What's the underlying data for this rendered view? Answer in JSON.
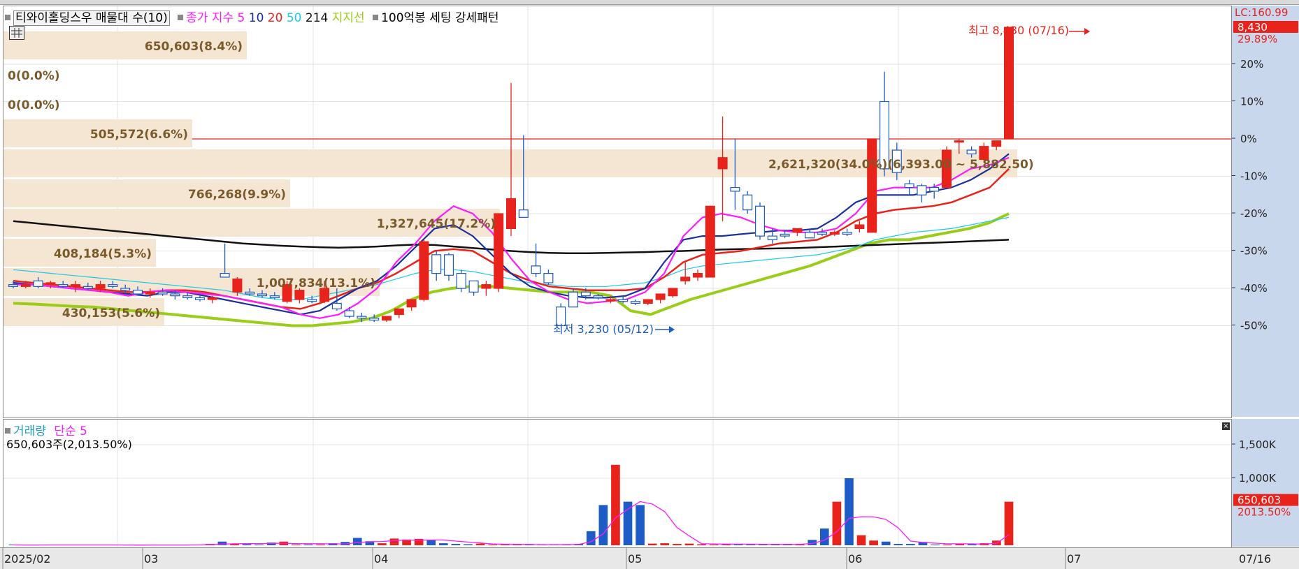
{
  "legend": {
    "stock_name": "티와이홀딩스우 매물대 수(10)",
    "ma_label": "종가 지수 5",
    "ma10": "10",
    "ma20": "20",
    "ma50": "50",
    "ma214": "214",
    "support_line": "지지선",
    "pattern_label": "100억봉 세팅 강세패턴"
  },
  "price_axis": {
    "lc_label": "LC:160.99",
    "current_price": "8,430",
    "current_change": "29.89%",
    "ticks": [
      "20%",
      "10%",
      "0%",
      "-10%",
      "-20%",
      "-30%",
      "-40%",
      "-50%"
    ]
  },
  "annotations": {
    "high": "최고 8,430 (07/16)",
    "low": "최저 3,230 (05/12)"
  },
  "volume_profile": [
    {
      "label": "650,603(8.4%)"
    },
    {
      "label": "0(0.0%)"
    },
    {
      "label": "0(0.0%)"
    },
    {
      "label": "505,572(6.6%)"
    },
    {
      "label": "2,621,320(34.0%)(6,393.00 ~ 5,882.50)"
    },
    {
      "label": "766,268(9.9%)"
    },
    {
      "label": "1,327,645(17.2%)"
    },
    {
      "label": "408,184(5.3%)"
    },
    {
      "label": "1,007,834(13.1%)"
    },
    {
      "label": "430,153(5.6%)"
    }
  ],
  "volume_panel": {
    "title": "거래량",
    "ma_label": "단순 5",
    "info": "650,603주(2,013.50%)",
    "axis_ticks": [
      "1,500K",
      "1,000K"
    ],
    "current_volume": "650,603",
    "current_pct": "2013.50%"
  },
  "date_axis": {
    "labels": [
      "2025/02",
      "03",
      "04",
      "05",
      "06",
      "07"
    ],
    "current_date": "07/16"
  },
  "colors": {
    "up": "#e8231b",
    "down": "#1d5bc6",
    "ma5": "#ff1aff",
    "ma10": "#1a2fa0",
    "ma20": "#e8231b",
    "ma50": "#1ec8e8",
    "ma214": "#111111",
    "support": "#9acd18",
    "profile_fill": "#f4e6d2",
    "profile_text": "#7a5a2a",
    "axis_bg": "#c9d7ec"
  },
  "chart_data": {
    "type": "candlestick",
    "reference_price": 6490,
    "price_pct_range": [
      -55,
      35
    ],
    "volume_range_k": [
      0,
      1700
    ],
    "candles": [
      {
        "date": "02/03",
        "o": -39,
        "h": -38,
        "l": -40,
        "c": -39.5
      },
      {
        "date": "02/05",
        "o": -39.5,
        "h": -38,
        "l": -40,
        "c": -39
      },
      {
        "date": "02/07",
        "o": -38,
        "h": -37,
        "l": -40,
        "c": -39.5
      },
      {
        "date": "02/10",
        "o": -39,
        "h": -38,
        "l": -40,
        "c": -38.5
      },
      {
        "date": "02/12",
        "o": -39,
        "h": -38,
        "l": -40,
        "c": -39.5
      },
      {
        "date": "02/14",
        "o": -39.5,
        "h": -38,
        "l": -41,
        "c": -39
      },
      {
        "date": "02/18",
        "o": -39.5,
        "h": -38.5,
        "l": -40.5,
        "c": -40
      },
      {
        "date": "02/20",
        "o": -40,
        "h": -38,
        "l": -41,
        "c": -39
      },
      {
        "date": "02/24",
        "o": -39,
        "h": -38,
        "l": -40,
        "c": -39.5
      },
      {
        "date": "02/26",
        "o": -40,
        "h": -39,
        "l": -41,
        "c": -40.5
      },
      {
        "date": "02/28",
        "o": -40.5,
        "h": -39.5,
        "l": -42,
        "c": -41.5
      },
      {
        "date": "03/04",
        "o": -41.5,
        "h": -40,
        "l": -42.5,
        "c": -41
      },
      {
        "date": "03/06",
        "o": -41,
        "h": -40,
        "l": -42,
        "c": -41.5
      },
      {
        "date": "03/10",
        "o": -41.5,
        "h": -40.5,
        "l": -43,
        "c": -42
      },
      {
        "date": "03/12",
        "o": -42,
        "h": -41,
        "l": -43,
        "c": -42.5
      },
      {
        "date": "03/14",
        "o": -42.5,
        "h": -41.5,
        "l": -43.5,
        "c": -43
      },
      {
        "date": "03/18",
        "o": -43,
        "h": -42,
        "l": -44,
        "c": -42.5
      },
      {
        "date": "03/20",
        "o": -36,
        "h": -28,
        "l": -37,
        "c": -37
      },
      {
        "date": "03/24",
        "o": -41,
        "h": -37,
        "l": -42,
        "c": -37.5
      },
      {
        "date": "03/26",
        "o": -41,
        "h": -40,
        "l": -42,
        "c": -41.5
      },
      {
        "date": "03/28",
        "o": -41.5,
        "h": -40.5,
        "l": -42.5,
        "c": -42
      },
      {
        "date": "04/01",
        "o": -42,
        "h": -41,
        "l": -43,
        "c": -42.5
      },
      {
        "date": "04/03",
        "o": -43.5,
        "h": -38,
        "l": -44,
        "c": -39
      },
      {
        "date": "04/07",
        "o": -43,
        "h": -40,
        "l": -44,
        "c": -40.5
      },
      {
        "date": "04/09",
        "o": -43,
        "h": -42,
        "l": -44,
        "c": -43.5
      },
      {
        "date": "04/11",
        "o": -43.5,
        "h": -38,
        "l": -44,
        "c": -40
      },
      {
        "date": "04/14",
        "o": -44,
        "h": -40,
        "l": -46,
        "c": -45.5
      },
      {
        "date": "04/16",
        "o": -46,
        "h": -45,
        "l": -48,
        "c": -47.5
      },
      {
        "date": "04/18",
        "o": -47.5,
        "h": -46.5,
        "l": -49,
        "c": -48
      },
      {
        "date": "04/21",
        "o": -48,
        "h": -47,
        "l": -49,
        "c": -48.5
      },
      {
        "date": "04/23",
        "o": -48.5,
        "h": -47.5,
        "l": -49,
        "c": -47.5
      },
      {
        "date": "04/25",
        "o": -47,
        "h": -46,
        "l": -48,
        "c": -45.5
      },
      {
        "date": "04/28",
        "o": -45,
        "h": -44,
        "l": -46,
        "c": -43
      },
      {
        "date": "04/30",
        "o": -43,
        "h": -27,
        "l": -43.5,
        "c": -27.5
      },
      {
        "date": "05/02",
        "o": -31,
        "h": -30,
        "l": -38,
        "c": -36
      },
      {
        "date": "05/06",
        "o": -31,
        "h": -30.5,
        "l": -38,
        "c": -36.5
      },
      {
        "date": "05/08",
        "o": -36,
        "h": -35,
        "l": -41,
        "c": -40
      },
      {
        "date": "05/09",
        "o": -38,
        "h": -38,
        "l": -42,
        "c": -41
      },
      {
        "date": "05/10",
        "o": -40,
        "h": -38,
        "l": -42,
        "c": -39
      },
      {
        "date": "05/12",
        "o": -40,
        "h": -20,
        "l": -41,
        "c": -20
      },
      {
        "date": "05/13",
        "o": -24,
        "h": 15,
        "l": -26,
        "c": -16
      },
      {
        "date": "05/14",
        "o": -19,
        "h": 1,
        "l": -21,
        "c": -21
      },
      {
        "date": "05/15",
        "o": -34,
        "h": -28,
        "l": -37,
        "c": -36
      },
      {
        "date": "05/16",
        "o": -36,
        "h": -35,
        "l": -39,
        "c": -38.5
      },
      {
        "date": "05/19",
        "o": -45,
        "h": -44,
        "l": -50,
        "c": -50
      },
      {
        "date": "05/20",
        "o": -41,
        "h": -40,
        "l": -45,
        "c": -45
      },
      {
        "date": "05/21",
        "o": -41,
        "h": -40,
        "l": -43,
        "c": -42
      },
      {
        "date": "05/22",
        "o": -42,
        "h": -41.5,
        "l": -43,
        "c": -42.5
      },
      {
        "date": "05/23",
        "o": -43,
        "h": -42,
        "l": -44,
        "c": -43
      },
      {
        "date": "05/26",
        "o": -43,
        "h": -42,
        "l": -44,
        "c": -43.5
      },
      {
        "date": "05/28",
        "o": -43.5,
        "h": -43,
        "l": -44.5,
        "c": -44
      },
      {
        "date": "05/30",
        "o": -44,
        "h": -43,
        "l": -44.5,
        "c": -43
      },
      {
        "date": "06/02",
        "o": -43,
        "h": -42,
        "l": -44,
        "c": -41.5
      },
      {
        "date": "06/04",
        "o": -42,
        "h": -40,
        "l": -42.5,
        "c": -40
      },
      {
        "date": "06/05",
        "o": -38,
        "h": -33,
        "l": -39,
        "c": -37
      },
      {
        "date": "06/09",
        "o": -37,
        "h": -35,
        "l": -38,
        "c": -36
      },
      {
        "date": "06/10",
        "o": -37,
        "h": -18,
        "l": -37,
        "c": -18
      },
      {
        "date": "06/11",
        "o": -8,
        "h": 6,
        "l": -22,
        "c": -5
      },
      {
        "date": "06/12",
        "o": -13,
        "h": 0,
        "l": -19,
        "c": -14
      },
      {
        "date": "06/13",
        "o": -15,
        "h": -14,
        "l": -20,
        "c": -19
      },
      {
        "date": "06/16",
        "o": -18,
        "h": -17,
        "l": -27,
        "c": -26
      },
      {
        "date": "06/17",
        "o": -26,
        "h": -24,
        "l": -28,
        "c": -27
      },
      {
        "date": "06/18",
        "o": -25.5,
        "h": -24.5,
        "l": -26.5,
        "c": -26
      },
      {
        "date": "06/19",
        "o": -25,
        "h": -24,
        "l": -26,
        "c": -24
      },
      {
        "date": "06/20",
        "o": -25,
        "h": -24,
        "l": -26,
        "c": -26.5
      },
      {
        "date": "06/23",
        "o": -25,
        "h": -24,
        "l": -26,
        "c": -25.5
      },
      {
        "date": "06/24",
        "o": -25.5,
        "h": -24.5,
        "l": -26,
        "c": -25
      },
      {
        "date": "06/25",
        "o": -25,
        "h": -24,
        "l": -26,
        "c": -25.5
      },
      {
        "date": "06/26",
        "o": -24,
        "h": -22,
        "l": -25,
        "c": -23
      },
      {
        "date": "06/30",
        "o": -25,
        "h": 0,
        "l": -25,
        "c": 0
      },
      {
        "date": "07/01",
        "o": 10,
        "h": 18,
        "l": -10,
        "c": -8
      },
      {
        "date": "07/02",
        "o": -3,
        "h": -1,
        "l": -11,
        "c": -9
      },
      {
        "date": "07/03",
        "o": -12,
        "h": -11,
        "l": -15,
        "c": -13
      },
      {
        "date": "07/04",
        "o": -12.5,
        "h": -12,
        "l": -17,
        "c": -15
      },
      {
        "date": "07/07",
        "o": -13,
        "h": -12,
        "l": -16,
        "c": -14
      },
      {
        "date": "07/08",
        "o": -13,
        "h": -2,
        "l": -13,
        "c": -3
      },
      {
        "date": "07/09",
        "o": -0.5,
        "h": 0,
        "l": -4,
        "c": -0.5
      },
      {
        "date": "07/10",
        "o": -3,
        "h": -2,
        "l": -5,
        "c": -4
      },
      {
        "date": "07/11",
        "o": -5.5,
        "h": -1,
        "l": -6,
        "c": -2
      },
      {
        "date": "07/14",
        "o": -2,
        "h": -0.5,
        "l": -3,
        "c": -0.5
      },
      {
        "date": "07/16",
        "o": 0,
        "h": 29.89,
        "l": 0,
        "c": 29.89
      }
    ],
    "moving_averages": {
      "ma5": [
        -39,
        -39,
        -39.5,
        -40,
        -40.5,
        -41,
        -42,
        -41,
        -40.5,
        -41,
        -41.5,
        -42,
        -43,
        -44,
        -45,
        -47,
        -48,
        -47,
        -44,
        -40,
        -33,
        -28,
        -22,
        -18,
        -20,
        -25,
        -32,
        -38,
        -41,
        -43,
        -44,
        -43.5,
        -43,
        -41,
        -36,
        -26,
        -21,
        -20,
        -21,
        -23,
        -24.5,
        -25,
        -25,
        -24,
        -20,
        -14,
        -13,
        -13,
        -13,
        -11,
        -8,
        -7,
        -5
      ],
      "ma10": [
        -38.5,
        -39,
        -39.5,
        -40,
        -40.5,
        -41,
        -41.5,
        -42,
        -41,
        -41,
        -42,
        -43,
        -44,
        -45,
        -46,
        -47,
        -46,
        -43,
        -40,
        -38,
        -34,
        -29,
        -24,
        -23,
        -26,
        -31,
        -36,
        -39.5,
        -41,
        -42,
        -42.5,
        -42.5,
        -42,
        -40,
        -33,
        -27,
        -26,
        -26,
        -25.5,
        -25,
        -24.5,
        -24.5,
        -24,
        -21,
        -17,
        -15,
        -15,
        -15,
        -14,
        -13,
        -11,
        -8,
        -4
      ],
      "ma20": [
        -38,
        -38.5,
        -39,
        -39.5,
        -40,
        -40.5,
        -41,
        -41,
        -40.5,
        -40.5,
        -41,
        -42,
        -43,
        -44,
        -45,
        -45.5,
        -44,
        -42,
        -40,
        -38.5,
        -36,
        -33,
        -30,
        -29.5,
        -30,
        -33,
        -36,
        -38,
        -39.5,
        -40,
        -40.5,
        -40.5,
        -40.5,
        -40,
        -37,
        -33,
        -31,
        -30.5,
        -30,
        -29,
        -28,
        -27.5,
        -27,
        -25,
        -22,
        -20,
        -19,
        -18.5,
        -18,
        -17,
        -15,
        -13,
        -8
      ],
      "ma50": [
        -35,
        -35.5,
        -36,
        -36.5,
        -37,
        -37.5,
        -38,
        -38.5,
        -39,
        -39.5,
        -40,
        -40.5,
        -41.5,
        -42.5,
        -43,
        -43,
        -42,
        -41,
        -40,
        -39,
        -37.5,
        -36,
        -35,
        -35,
        -35.5,
        -36.5,
        -37.5,
        -38.5,
        -39,
        -39.5,
        -39.5,
        -39.5,
        -39,
        -38.5,
        -37,
        -35,
        -34,
        -33.5,
        -33,
        -32.5,
        -32,
        -31.5,
        -31,
        -30,
        -29,
        -27,
        -26,
        -25,
        -24.5,
        -24,
        -23,
        -22,
        -21
      ],
      "ma214": [
        -22,
        -22.5,
        -23,
        -23.5,
        -24,
        -24.5,
        -25,
        -25.5,
        -26,
        -26.5,
        -27,
        -27.5,
        -28,
        -28.3,
        -28.6,
        -28.8,
        -29,
        -29.1,
        -29,
        -28.8,
        -28.5,
        -28.3,
        -28.4,
        -28.8,
        -29.2,
        -29.6,
        -30,
        -30.3,
        -30.5,
        -30.6,
        -30.6,
        -30.5,
        -30.4,
        -30.3,
        -30.1,
        -30,
        -29.8,
        -29.6,
        -29.5,
        -29.4,
        -29.3,
        -29.2,
        -29,
        -28.8,
        -28.6,
        -28.4,
        -28.2,
        -28,
        -27.8,
        -27.6,
        -27.4,
        -27.2,
        -27
      ]
    },
    "support_line": [
      -44,
      -44.2,
      -44.5,
      -44.8,
      -45,
      -45.5,
      -46,
      -46.5,
      -47,
      -47.5,
      -48,
      -48.5,
      -49,
      -49.5,
      -50,
      -50,
      -49.5,
      -49,
      -48,
      -46,
      -43,
      -41,
      -40,
      -39.5,
      -39.5,
      -40,
      -40.5,
      -41,
      -41,
      -41,
      -42,
      -46,
      -47,
      -45,
      -43,
      -41.5,
      -40,
      -38.5,
      -37,
      -35.5,
      -34,
      -32,
      -30,
      -28,
      -27,
      -27,
      -26,
      -25,
      -24,
      -22.5,
      -20
    ],
    "volume_k": [
      5,
      4,
      5,
      6,
      8,
      5,
      4,
      3,
      4,
      3,
      3,
      4,
      8,
      4,
      3,
      5,
      20,
      55,
      25,
      15,
      10,
      40,
      55,
      5,
      5,
      8,
      30,
      50,
      110,
      60,
      30,
      100,
      85,
      95,
      80,
      30,
      20,
      15,
      25,
      8,
      10,
      10,
      8,
      9,
      10,
      15,
      20,
      210,
      600,
      1200,
      650,
      600,
      25,
      30,
      20,
      25,
      15,
      10,
      20,
      15,
      18,
      10,
      10,
      15,
      20,
      80,
      250,
      650,
      1000,
      150,
      70,
      55,
      20,
      20,
      50,
      10,
      10,
      20,
      15,
      30,
      70,
      650
    ]
  }
}
